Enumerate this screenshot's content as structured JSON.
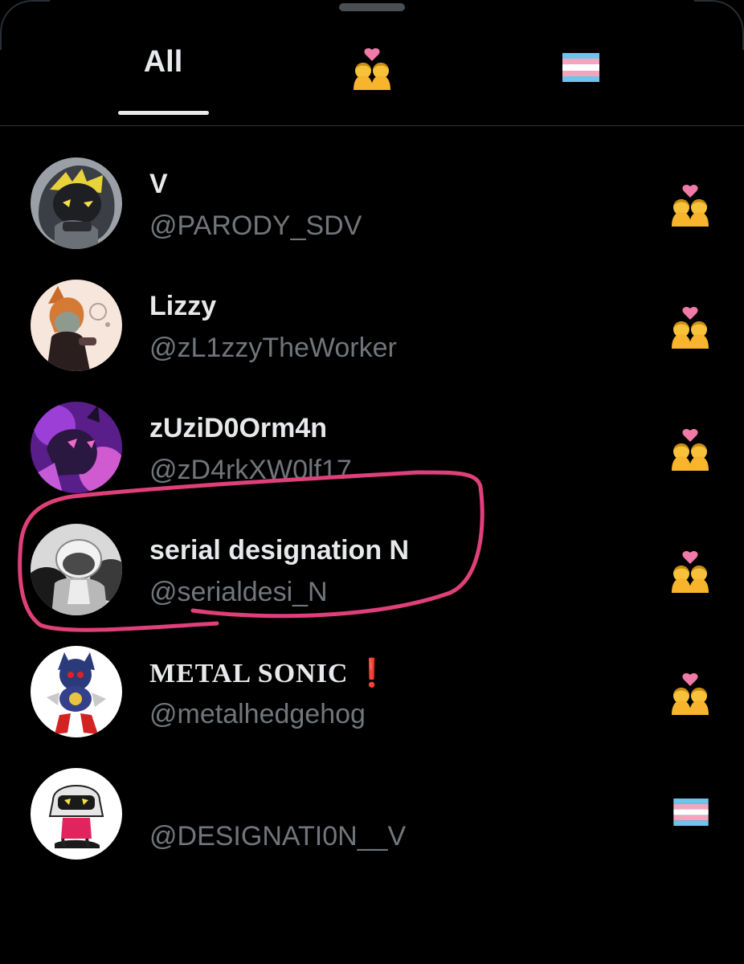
{
  "tabs": {
    "all_label": "All",
    "couple_icon": "couple-with-heart-icon",
    "flag_icon": "transgender-flag-icon",
    "selected": "All"
  },
  "accounts": [
    {
      "name": "V",
      "handle": "@PARODY_SDV",
      "badge": "couple-with-heart-icon"
    },
    {
      "name": "Lizzy",
      "handle": "@zL1zzyTheWorker",
      "badge": "couple-with-heart-icon"
    },
    {
      "name": "zUziD0Orm4n",
      "handle": "@zD4rkXW0lf17",
      "badge": "couple-with-heart-icon"
    },
    {
      "name": "serial designation N",
      "handle": "@serialdesi_N",
      "badge": "couple-with-heart-icon",
      "circled": true
    },
    {
      "name": "METAL SONIC",
      "name_suffix": "❗",
      "handle": "@metalhedgehog",
      "badge": "couple-with-heart-icon"
    },
    {
      "name": "",
      "handle": "@DESIGNATI0N__V",
      "badge": "transgender-flag-icon"
    }
  ],
  "colors": {
    "background": "#000000",
    "text_primary": "#e7e9ea",
    "text_secondary": "#71767b",
    "annotation": "#e0407a"
  }
}
